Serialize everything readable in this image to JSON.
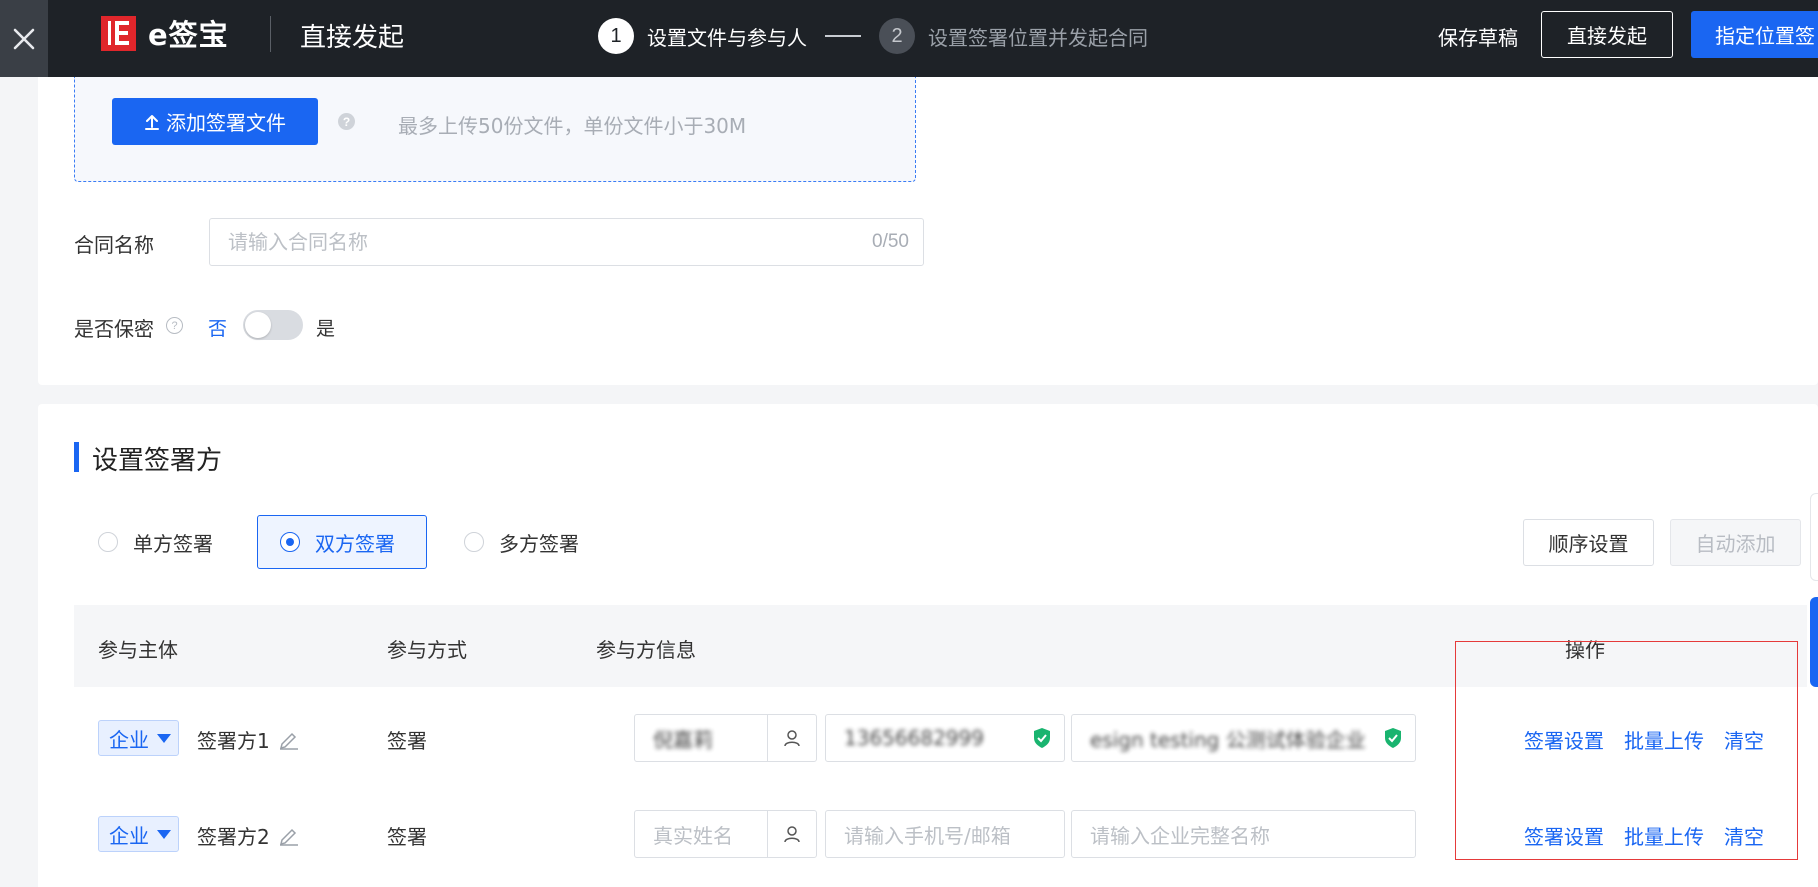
{
  "header": {
    "logo_text": "e签宝",
    "page_title": "直接发起",
    "steps": [
      {
        "num": "1",
        "label": "设置文件与参与人",
        "active": true
      },
      {
        "num": "2",
        "label": "设置签署位置并发起合同",
        "active": false
      }
    ],
    "save_draft": "保存草稿",
    "direct_send": "直接发起",
    "locate_sign": "指定位置签"
  },
  "upload": {
    "button_label": "添加签署文件",
    "hint": "最多上传50份文件，单份文件小于30M"
  },
  "contract_name": {
    "label": "合同名称",
    "placeholder": "请输入合同名称",
    "count": "0/50"
  },
  "confidential": {
    "label": "是否保密",
    "no": "否",
    "yes": "是",
    "enabled": false
  },
  "signers_section": {
    "title": "设置签署方",
    "modes": [
      "单方签署",
      "双方签署",
      "多方签署"
    ],
    "selected_mode": "双方签署",
    "order_button": "顺序设置",
    "auto_add_button": "自动添加"
  },
  "table": {
    "headers": [
      "参与主体",
      "参与方式",
      "参与方信息",
      "操作"
    ],
    "rows": [
      {
        "type": "企业",
        "name": "签署方1",
        "mode": "签署",
        "real_name": "倪嘉莉",
        "contact": "13656682999",
        "company": "esign testing 公测试体验企业",
        "actions": [
          "签署设置",
          "批量上传",
          "清空"
        ]
      },
      {
        "type": "企业",
        "name": "签署方2",
        "mode": "签署",
        "real_name_placeholder": "真实姓名",
        "contact_placeholder": "请输入手机号/邮箱",
        "company_placeholder": "请输入企业完整名称",
        "actions": [
          "签署设置",
          "批量上传",
          "清空"
        ]
      }
    ]
  },
  "colors": {
    "primary": "#1a66f2",
    "topbar": "#1e2227",
    "logo_red": "#e0262b",
    "highlight": "#e53a3a",
    "verified": "#19b46f"
  },
  "icons": [
    "close-icon",
    "upload-icon",
    "help-icon",
    "edit-icon",
    "user-icon",
    "verified-shield-icon",
    "caret-down-icon"
  ]
}
